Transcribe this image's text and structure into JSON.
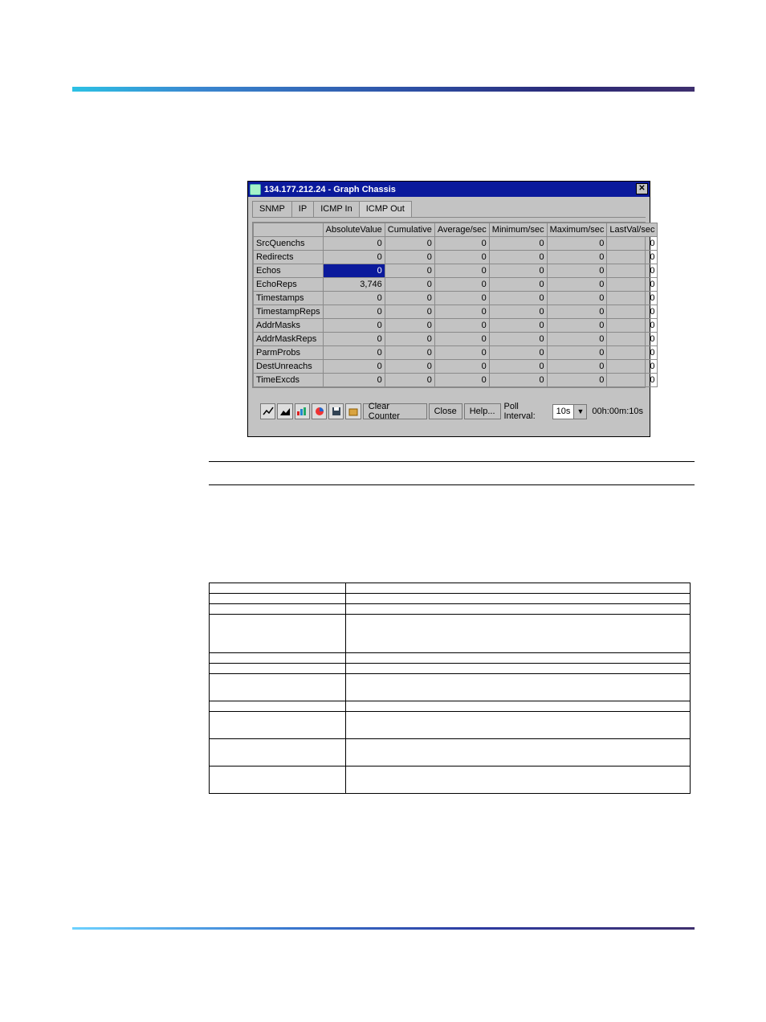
{
  "chapter_running_head": "",
  "top_rule": true,
  "shot": {
    "system_icon": "app-icon",
    "title": "134.177.212.24 - Graph Chassis",
    "close": "✕",
    "tabs": [
      {
        "label": "SNMP",
        "active": false
      },
      {
        "label": "IP",
        "active": false
      },
      {
        "label": "ICMP In",
        "active": false
      },
      {
        "label": "ICMP Out",
        "active": true
      }
    ],
    "columns": [
      "",
      "AbsoluteValue",
      "Cumulative",
      "Average/sec",
      "Minimum/sec",
      "Maximum/sec",
      "LastVal/sec"
    ],
    "rows": [
      {
        "name": "SrcQuenchs",
        "vals": [
          "0",
          "0",
          "0",
          "0",
          "0",
          "0"
        ],
        "selected": false
      },
      {
        "name": "Redirects",
        "vals": [
          "0",
          "0",
          "0",
          "0",
          "0",
          "0"
        ],
        "selected": false
      },
      {
        "name": "Echos",
        "vals": [
          "0",
          "0",
          "0",
          "0",
          "0",
          "0"
        ],
        "selected": true
      },
      {
        "name": "EchoReps",
        "vals": [
          "3,746",
          "0",
          "0",
          "0",
          "0",
          "0"
        ],
        "selected": false
      },
      {
        "name": "Timestamps",
        "vals": [
          "0",
          "0",
          "0",
          "0",
          "0",
          "0"
        ],
        "selected": false
      },
      {
        "name": "TimestampReps",
        "vals": [
          "0",
          "0",
          "0",
          "0",
          "0",
          "0"
        ],
        "selected": false
      },
      {
        "name": "AddrMasks",
        "vals": [
          "0",
          "0",
          "0",
          "0",
          "0",
          "0"
        ],
        "selected": false
      },
      {
        "name": "AddrMaskReps",
        "vals": [
          "0",
          "0",
          "0",
          "0",
          "0",
          "0"
        ],
        "selected": false
      },
      {
        "name": "ParmProbs",
        "vals": [
          "0",
          "0",
          "0",
          "0",
          "0",
          "0"
        ],
        "selected": false
      },
      {
        "name": "DestUnreachs",
        "vals": [
          "0",
          "0",
          "0",
          "0",
          "0",
          "0"
        ],
        "selected": false
      },
      {
        "name": "TimeExcds",
        "vals": [
          "0",
          "0",
          "0",
          "0",
          "0",
          "0"
        ],
        "selected": false
      }
    ],
    "toolbar": {
      "icons": [
        "line-chart-icon",
        "area-chart-icon",
        "bar-chart-icon",
        "pie-chart-icon",
        "save-icon",
        "export-icon"
      ],
      "clear": "Clear Counter",
      "close": "Close",
      "help": "Help...",
      "poll_label": "Poll Interval:",
      "poll_value": "10s",
      "elapsed": "00h:00m:10s"
    }
  },
  "figure_caption": "",
  "body_text": "",
  "table_title": "",
  "doc_table": {
    "headers": [
      "",
      ""
    ],
    "rows": [
      {
        "c1": "",
        "c2": "",
        "h": "n"
      },
      {
        "c1": "",
        "c2": "",
        "h": "n"
      },
      {
        "c1": "",
        "c2": "",
        "h": "tall"
      },
      {
        "c1": "",
        "c2": "",
        "h": "n"
      },
      {
        "c1": "",
        "c2": "",
        "h": "n"
      },
      {
        "c1": "",
        "c2": "",
        "h": "mid"
      },
      {
        "c1": "",
        "c2": "",
        "h": "n"
      },
      {
        "c1": "",
        "c2": "",
        "h": "mid"
      },
      {
        "c1": "",
        "c2": "",
        "h": "mid"
      },
      {
        "c1": "",
        "c2": "",
        "h": "mid"
      }
    ]
  },
  "footer_left": "",
  "footer_right": ""
}
